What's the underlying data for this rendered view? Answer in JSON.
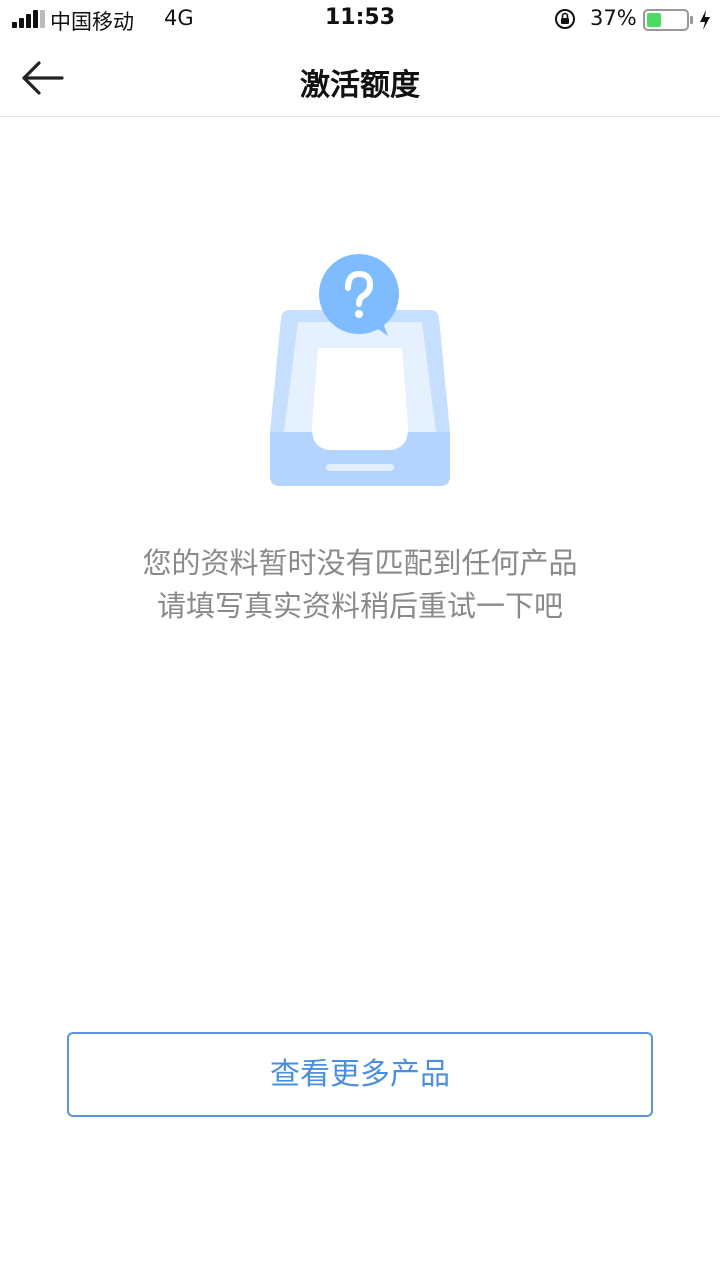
{
  "status_bar": {
    "carrier": "中国移动",
    "network": "4G",
    "time": "11:53",
    "battery_percent": "37%",
    "battery_level": 0.37,
    "signal_icon": "signal-bars-icon",
    "lock_icon": "orientation-lock-icon",
    "charge_icon": "charging-bolt-icon"
  },
  "nav": {
    "title": "激活额度",
    "back_icon": "arrow-left-icon"
  },
  "empty_state": {
    "illustration": "inbox-question-icon",
    "line1": "您的资料暂时没有匹配到任何产品",
    "line2": "请填写真实资料稍后重试一下吧"
  },
  "actions": {
    "more_products_label": "查看更多产品"
  },
  "colors": {
    "accent": "#4a8fe0",
    "button_border": "#5a96db",
    "message_text": "#8a8a8a",
    "illustration_light": "#cfe4ff",
    "illustration_dark": "#7fbcff",
    "battery_fill": "#4cd964"
  }
}
